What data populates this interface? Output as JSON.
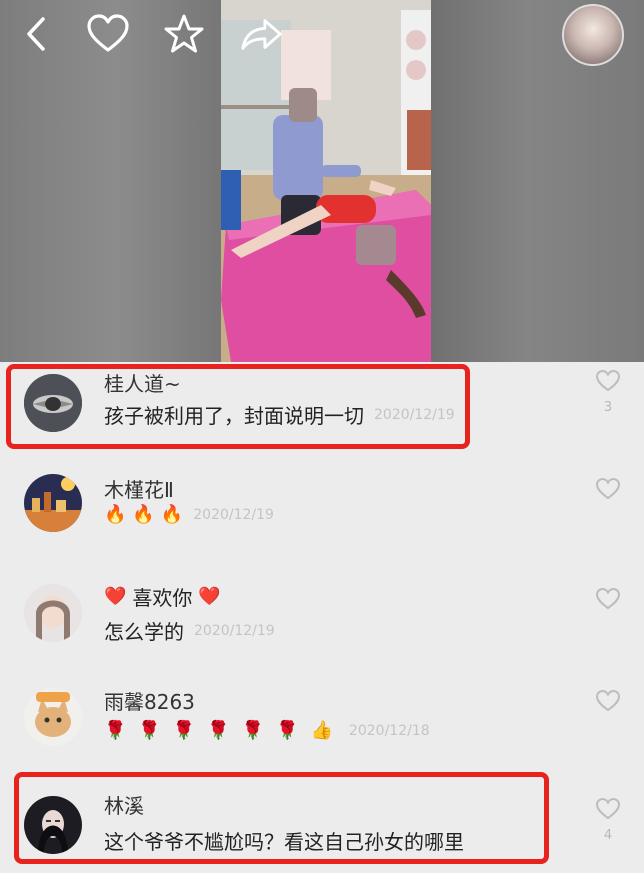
{
  "colors": {
    "highlight": "#e8231d",
    "date": "#c4c4c4",
    "text": "#222222",
    "background": "#ececec"
  },
  "top_bar": {
    "icons": [
      "back-icon",
      "heart-icon",
      "star-icon",
      "share-icon"
    ]
  },
  "comments": [
    {
      "username": "桂人道~",
      "text": "孩子被利用了，封面说明一切",
      "date": "2020/12/19",
      "likes": "3",
      "highlighted": true
    },
    {
      "username": "木槿花Ⅱ",
      "emojis": [
        "🔥",
        "🔥",
        "🔥"
      ],
      "date": "2020/12/19",
      "likes": "",
      "highlighted": false
    },
    {
      "username_prefix": "❤️",
      "username": "喜欢你",
      "username_suffix": "❤️",
      "text": "怎么学的",
      "date": "2020/12/19",
      "likes": "",
      "highlighted": false
    },
    {
      "username": "雨馨8263",
      "emojis": [
        "🌹",
        "🌹",
        "🌹",
        "🌹",
        "🌹",
        "🌹",
        "👍"
      ],
      "date": "2020/12/18",
      "likes": "",
      "highlighted": false
    },
    {
      "username": "林溪",
      "text": "这个爷爷不尴尬吗？看这自己孙女的哪里",
      "date": "",
      "likes": "4",
      "highlighted": true
    }
  ]
}
